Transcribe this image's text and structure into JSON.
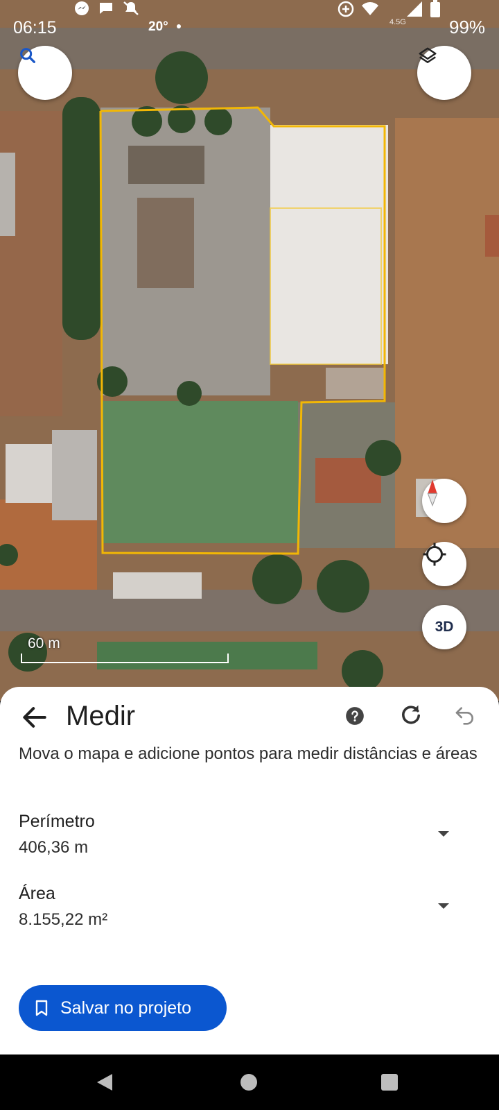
{
  "status_bar": {
    "time": "06:15",
    "temperature": "20°",
    "network": "4.5G",
    "battery": "99%"
  },
  "map": {
    "scale_label": "60 m"
  },
  "controls": {
    "three_d_label": "3D"
  },
  "measure": {
    "title": "Medir",
    "description": "Mova o mapa e adicione pontos para medir distâncias e áreas",
    "perimeter_label": "Perímetro",
    "perimeter_value": "406,36 m",
    "area_label": "Área",
    "area_value": "8.155,22 m²",
    "save_label": "Salvar no projeto"
  },
  "colors": {
    "accent": "#0b57d0",
    "measure_outline": "#f2b705"
  }
}
